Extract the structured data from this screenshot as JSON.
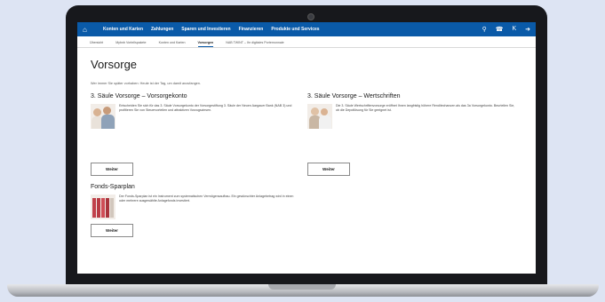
{
  "nav": {
    "items": [
      "Konten und Karten",
      "Zahlungen",
      "Sparen und Investieren",
      "Finanzieren",
      "Produkte und Services"
    ]
  },
  "subnav": {
    "items": [
      "Übersicht",
      "Mybnb Vorteilspakete",
      "Konten und Karten",
      "Vorsorgen",
      "NAB TWINT – Ihr digitales Portemonnaie"
    ],
    "active_index": 3
  },
  "page": {
    "title": "Vorsorge",
    "intro": "Wer immer Sie später vorhaben: Heute ist der Tag, um damit anzufangen."
  },
  "sections": [
    {
      "title": "3. Säule Vorsorge – Vorsorgekonto",
      "text": "Entscheiden Sie sich für das 3. Säule Vorsorgekonto der Vorsorgestiftung 3. Säule der Neuen Aargauer Bank (NAB 3) und profitieren Sie von Steuervorteilen und attraktiven Vorzugszinsen.",
      "button": "Weiter"
    },
    {
      "title": "3. Säule Vorsorge – Wertschriften",
      "text": "Die 3. Säule Wertschriftenvorsorge eröffnet Ihnen langfristig höhere Renditechancen als das 3a Vorsorgekonto. Beurteilen Sie, ob die Depotlösung für Sie geeignet ist.",
      "button": "Weiter"
    },
    {
      "title": "Fonds-Sparplan",
      "text": "Der Fonds-Sparplan ist ein Instrument zum systematischen Vermögensaufbau. Ein gewünschter Anlagebetrag wird in einen oder mehrere ausgewählte Anlagefonds investiert.",
      "button": "Weiter"
    }
  ],
  "icons": {
    "home": "home-icon",
    "location": "location-icon",
    "phone": "phone-icon",
    "user": "user-icon",
    "logout": "logout-icon"
  },
  "colors": {
    "brand": "#0a5aa8",
    "background": "#dde4f3"
  }
}
